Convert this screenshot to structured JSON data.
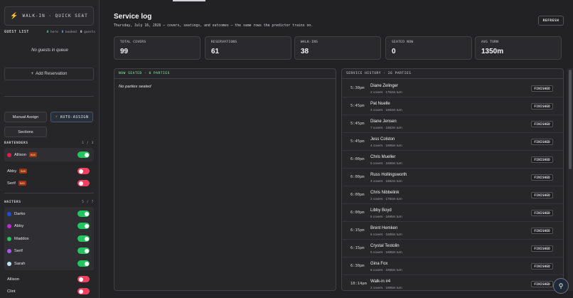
{
  "sidebar": {
    "walkin_label": "WALK-IN · QUICK SEAT",
    "guest_list": {
      "title": "GUEST LIST",
      "here_count": "0",
      "here_label": "here",
      "booked_count": "0",
      "booked_label": "booked",
      "guests_count": "0",
      "guests_label": "guests"
    },
    "queue_empty": "No guests in queue",
    "add_reservation": "Add Reservation",
    "manual_assign": "Manual Assign",
    "auto_assign": "AUTO-ASSIGN",
    "sections": "Sections",
    "bartenders": {
      "title": "BARTENDERS",
      "count": "1 / 3",
      "rows": [
        {
          "name": "Allison",
          "badge": "BAR",
          "dot": "#e11d48",
          "on": true
        },
        {
          "name": "Abby",
          "badge": "BAR",
          "dot": "",
          "on": false
        },
        {
          "name": "Serif",
          "badge": "BAR",
          "dot": "",
          "on": false
        }
      ]
    },
    "waiters": {
      "title": "WAITERS",
      "count": "5 / 7",
      "rows": [
        {
          "name": "Darko",
          "dot": "#1d4ed8",
          "on": true
        },
        {
          "name": "Abby",
          "dot": "#c026d3",
          "on": true
        },
        {
          "name": "Maddox",
          "dot": "#22c55e",
          "on": true
        },
        {
          "name": "Serif",
          "dot": "#a855f7",
          "on": true
        },
        {
          "name": "Sarah",
          "dot": "#bae6fd",
          "on": true
        },
        {
          "name": "Allison",
          "dot": "",
          "on": false
        },
        {
          "name": "Clint",
          "dot": "",
          "on": false
        }
      ]
    }
  },
  "header": {
    "title": "Service log",
    "subtitle": "Thursday, July 16, 2026 — covers, seatings, and outcomes — the same rows the predictor trains on.",
    "refresh": "REFRESH"
  },
  "stats": [
    {
      "label": "TOTAL COVERS",
      "value": "99"
    },
    {
      "label": "RESERVATIONS",
      "value": "61"
    },
    {
      "label": "WALK-INS",
      "value": "38"
    },
    {
      "label": "SEATED NOW",
      "value": "0"
    },
    {
      "label": "AVG TURN",
      "value": "1350m"
    }
  ],
  "seated": {
    "title": "NOW SEATED · 0 PARTIES",
    "empty": "No parties seated"
  },
  "history": {
    "title": "SERVICE HISTORY · 26 PARTIES",
    "rows": [
      {
        "time": "5:30pm",
        "name": "Diane Zelinger",
        "meta": "2 covers · 1754m turn",
        "status": "FINISHED"
      },
      {
        "time": "5:45pm",
        "name": "Pat Nuelle",
        "meta": "4 covers · 1694m turn",
        "status": "FINISHED"
      },
      {
        "time": "5:45pm",
        "name": "Diane Jensen",
        "meta": "7 covers · 1683m turn",
        "status": "FINISHED"
      },
      {
        "time": "5:45pm",
        "name": "Jess Colston",
        "meta": "4 covers · 1695m turn",
        "status": "FINISHED"
      },
      {
        "time": "6:00pm",
        "name": "Chris Mueller",
        "meta": "5 covers · 1695m turn",
        "status": "FINISHED"
      },
      {
        "time": "6:00pm",
        "name": "Russ Hollingsworth",
        "meta": "4 covers · 1682m turn",
        "status": "FINISHED"
      },
      {
        "time": "6:00pm",
        "name": "Chris Nibbelink",
        "meta": "2 covers · 1784m turn",
        "status": "FINISHED"
      },
      {
        "time": "6:00pm",
        "name": "Libby Boyd",
        "meta": "5 covers · 1695m turn",
        "status": "FINISHED"
      },
      {
        "time": "6:15pm",
        "name": "Brent Hemken",
        "meta": "6 covers · 1695m turn",
        "status": "FINISHED"
      },
      {
        "time": "6:15pm",
        "name": "Crystal Testolin",
        "meta": "5 covers · 1695m turn",
        "status": "FINISHED"
      },
      {
        "time": "6:30pm",
        "name": "Gina Fox",
        "meta": "6 covers · 1695m turn",
        "status": "FINISHED"
      },
      {
        "time": "10:14pm",
        "name": "Walk-in #4",
        "meta": "2 covers · 1695m turn",
        "status": "FINISHED"
      }
    ]
  },
  "colors": {
    "accent_green": "#22c55e",
    "accent_red": "#f43f5e",
    "bolt_orange": "#f97316"
  },
  "icons": {
    "walkin": "bolt-icon",
    "auto_assign": "bolt-icon",
    "fab": "assistant-icon",
    "add": "plus-icon"
  }
}
